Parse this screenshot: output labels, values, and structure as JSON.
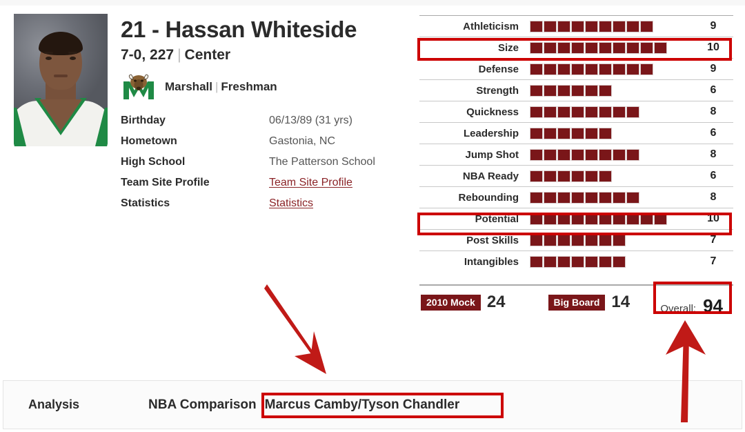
{
  "player": {
    "name": "21 - Hassan Whiteside",
    "height": "7-0, 227",
    "position": "Center",
    "team": "Marshall",
    "class": "Freshman",
    "team_logo_icon": "marshall-herd-logo-icon",
    "photo_icon": "player-headshot-photo",
    "bio": [
      {
        "label": "Birthday",
        "value": "06/13/89 (31 yrs)",
        "link": false
      },
      {
        "label": "Hometown",
        "value": "Gastonia, NC",
        "link": false
      },
      {
        "label": "High School",
        "value": "The Patterson School",
        "link": false
      },
      {
        "label": "Team Site Profile",
        "value": "Team Site Profile",
        "link": true
      },
      {
        "label": "Statistics",
        "value": "Statistics",
        "link": true
      }
    ]
  },
  "ratings": {
    "max": 10,
    "rows": [
      {
        "label": "Athleticism",
        "value": 9
      },
      {
        "label": "Size",
        "value": 10
      },
      {
        "label": "Defense",
        "value": 9
      },
      {
        "label": "Strength",
        "value": 6
      },
      {
        "label": "Quickness",
        "value": 8
      },
      {
        "label": "Leadership",
        "value": 6
      },
      {
        "label": "Jump Shot",
        "value": 8
      },
      {
        "label": "NBA Ready",
        "value": 6
      },
      {
        "label": "Rebounding",
        "value": 8
      },
      {
        "label": "Potential",
        "value": 10
      },
      {
        "label": "Post Skills",
        "value": 7
      },
      {
        "label": "Intangibles",
        "value": 7
      }
    ]
  },
  "summary": {
    "mock_label": "2010 Mock",
    "mock_value": "24",
    "bigboard_label": "Big Board",
    "bigboard_value": "14",
    "overall_label": "Overall:",
    "overall_value": "94"
  },
  "analysis": {
    "title": "Analysis",
    "comparison_label": "NBA Comparison",
    "comparison_value": "Marcus Camby/Tyson Chandler"
  },
  "colors": {
    "bar_fill": "#7a1619",
    "badge": "#7a1619",
    "link": "#8a2226",
    "annotation_red": "#cc0000",
    "team_green": "#1f8a45"
  }
}
